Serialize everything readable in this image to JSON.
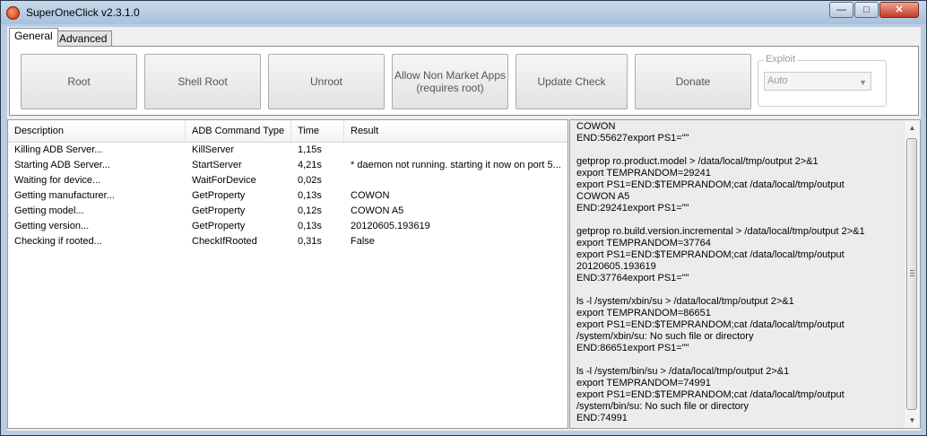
{
  "window": {
    "title": "SuperOneClick v2.3.1.0",
    "close": "✕",
    "min": "—",
    "max": "□"
  },
  "tabs": [
    {
      "label": "General"
    },
    {
      "label": "Advanced"
    }
  ],
  "actions": {
    "root": "Root",
    "shell_root": "Shell Root",
    "unroot": "Unroot",
    "allow_non_market_line1": "Allow Non Market Apps",
    "allow_non_market_line2": "(requires root)",
    "update_check": "Update Check",
    "donate": "Donate"
  },
  "exploit": {
    "legend": "Exploit",
    "selected": "Auto"
  },
  "table": {
    "columns": [
      "Description",
      "ADB Command Type",
      "Time",
      "Result"
    ],
    "rows": [
      {
        "description": "Killing ADB Server...",
        "command": "KillServer",
        "time": "1,15s",
        "result": ""
      },
      {
        "description": "Starting ADB Server...",
        "command": "StartServer",
        "time": "4,21s",
        "result": "* daemon not running. starting it now on port 5..."
      },
      {
        "description": "Waiting for device...",
        "command": "WaitForDevice",
        "time": "0,02s",
        "result": ""
      },
      {
        "description": "Getting manufacturer...",
        "command": "GetProperty",
        "time": "0,13s",
        "result": "COWON"
      },
      {
        "description": "Getting model...",
        "command": "GetProperty",
        "time": "0,12s",
        "result": "COWON A5"
      },
      {
        "description": "Getting version...",
        "command": "GetProperty",
        "time": "0,13s",
        "result": "20120605.193619"
      },
      {
        "description": "Checking if rooted...",
        "command": "CheckIfRooted",
        "time": "0,31s",
        "result": "False"
      }
    ]
  },
  "log": {
    "text": "COWON\nEND:55627export PS1=\"\"\n\ngetprop ro.product.model > /data/local/tmp/output 2>&1\nexport TEMPRANDOM=29241\nexport PS1=END:$TEMPRANDOM;cat /data/local/tmp/output\nCOWON A5\nEND:29241export PS1=\"\"\n\ngetprop ro.build.version.incremental > /data/local/tmp/output 2>&1\nexport TEMPRANDOM=37764\nexport PS1=END:$TEMPRANDOM;cat /data/local/tmp/output\n20120605.193619\nEND:37764export PS1=\"\"\n\nls -l /system/xbin/su > /data/local/tmp/output 2>&1\nexport TEMPRANDOM=86651\nexport PS1=END:$TEMPRANDOM;cat /data/local/tmp/output\n/system/xbin/su: No such file or directory\nEND:86651export PS1=\"\"\n\nls -l /system/bin/su > /data/local/tmp/output 2>&1\nexport TEMPRANDOM=74991\nexport PS1=END:$TEMPRANDOM;cat /data/local/tmp/output\n/system/bin/su: No such file or directory\nEND:74991"
  },
  "icons": {
    "app": "app-icon",
    "scroll_up": "▲",
    "scroll_down": "▼",
    "dropdown": "▼"
  }
}
